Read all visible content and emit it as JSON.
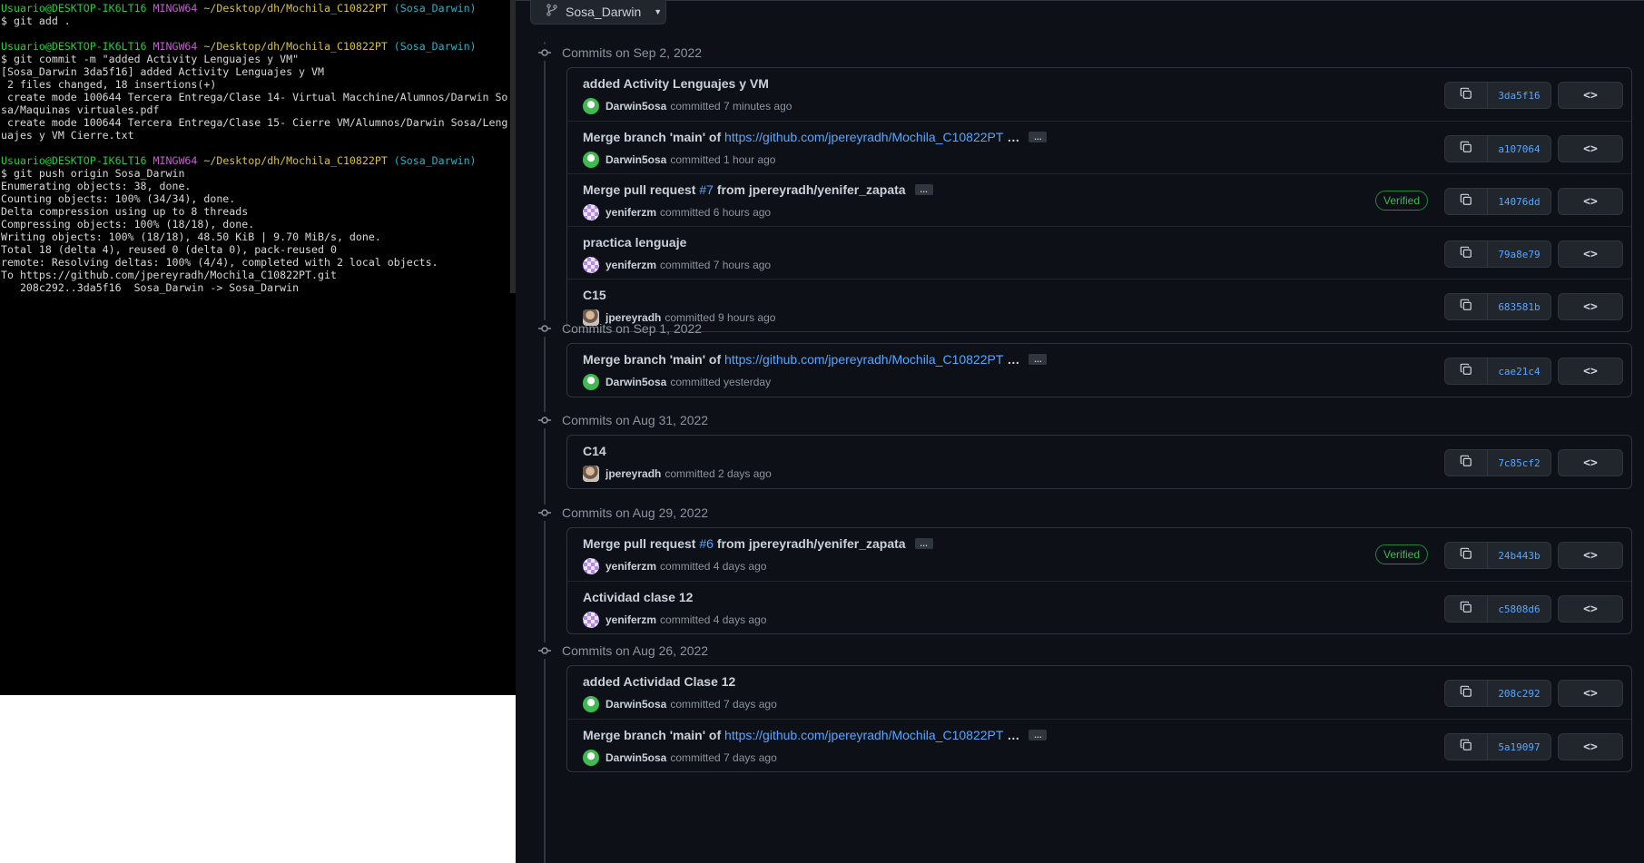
{
  "terminal": {
    "lines": [
      {
        "type": "prompt",
        "user": "Usuario@DESKTOP-IK6LT16",
        "sys": "MINGW64",
        "path": "~/Desktop/dh/Mochila_C10822PT",
        "branch": "(Sosa_Darwin)"
      },
      {
        "type": "text",
        "text": "$ git add ."
      },
      {
        "type": "blank"
      },
      {
        "type": "prompt",
        "user": "Usuario@DESKTOP-IK6LT16",
        "sys": "MINGW64",
        "path": "~/Desktop/dh/Mochila_C10822PT",
        "branch": "(Sosa_Darwin)"
      },
      {
        "type": "text",
        "text": "$ git commit -m \"added Activity Lenguajes y VM\""
      },
      {
        "type": "text",
        "text": "[Sosa_Darwin 3da5f16] added Activity Lenguajes y VM"
      },
      {
        "type": "text",
        "text": " 2 files changed, 18 insertions(+)"
      },
      {
        "type": "text",
        "text": " create mode 100644 Tercera Entrega/Clase 14- Virtual Macchine/Alumnos/Darwin So"
      },
      {
        "type": "text",
        "text": "sa/Maquinas virtuales.pdf"
      },
      {
        "type": "text",
        "text": " create mode 100644 Tercera Entrega/Clase 15- Cierre VM/Alumnos/Darwin Sosa/Leng"
      },
      {
        "type": "text",
        "text": "uajes y VM Cierre.txt"
      },
      {
        "type": "blank"
      },
      {
        "type": "prompt",
        "user": "Usuario@DESKTOP-IK6LT16",
        "sys": "MINGW64",
        "path": "~/Desktop/dh/Mochila_C10822PT",
        "branch": "(Sosa_Darwin)"
      },
      {
        "type": "text",
        "text": "$ git push origin Sosa_Darwin"
      },
      {
        "type": "text",
        "text": "Enumerating objects: 38, done."
      },
      {
        "type": "text",
        "text": "Counting objects: 100% (34/34), done."
      },
      {
        "type": "text",
        "text": "Delta compression using up to 8 threads"
      },
      {
        "type": "text",
        "text": "Compressing objects: 100% (18/18), done."
      },
      {
        "type": "text",
        "text": "Writing objects: 100% (18/18), 48.50 KiB | 9.70 MiB/s, done."
      },
      {
        "type": "text",
        "text": "Total 18 (delta 4), reused 0 (delta 0), pack-reused 0"
      },
      {
        "type": "text",
        "text": "remote: Resolving deltas: 100% (4/4), completed with 2 local objects."
      },
      {
        "type": "text",
        "text": "To https://github.com/jpereyradh/Mochila_C10822PT.git"
      },
      {
        "type": "text",
        "text": "   208c292..3da5f16  Sosa_Darwin -> Sosa_Darwin"
      }
    ]
  },
  "github": {
    "branch": "Sosa_Darwin",
    "groups": [
      {
        "heading": "Commits on Sep 2, 2022",
        "commits": [
          {
            "message": "added Activity Lenguajes y VM",
            "author": "Darwin5osa",
            "time": "committed 7 minutes ago",
            "sha": "3da5f16",
            "avatar": "green",
            "verified": "",
            "more": false
          },
          {
            "message": "Merge branch 'main' of",
            "link": "https://github.com/jpereyradh/Mochila_C10822PT",
            "message_tail": " …",
            "author": "Darwin5osa",
            "time": "committed 1 hour ago",
            "sha": "a107064",
            "avatar": "green",
            "verified": "",
            "more": true
          },
          {
            "message": "Merge pull request",
            "link": "#7",
            "message_tail": " from jpereyradh/yenifer_zapata",
            "author": "yeniferzm",
            "time": "committed 6 hours ago",
            "sha": "14076dd",
            "avatar": "purple",
            "verified": "Verified",
            "more": true
          },
          {
            "message": "practica lenguaje",
            "author": "yeniferzm",
            "time": "committed 7 hours ago",
            "sha": "79a8e79",
            "avatar": "purple",
            "verified": "",
            "more": false
          },
          {
            "message": "C15",
            "author": "jpereyradh",
            "time": "committed 9 hours ago",
            "sha": "683581b",
            "avatar": "photo",
            "verified": "",
            "more": false
          }
        ]
      },
      {
        "heading": "Commits on Sep 1, 2022",
        "commits": [
          {
            "message": "Merge branch 'main' of",
            "link": "https://github.com/jpereyradh/Mochila_C10822PT",
            "message_tail": " …",
            "author": "Darwin5osa",
            "time": "committed yesterday",
            "sha": "cae21c4",
            "avatar": "green",
            "verified": "",
            "more": true
          }
        ]
      },
      {
        "heading": "Commits on Aug 31, 2022",
        "commits": [
          {
            "message": "C14",
            "author": "jpereyradh",
            "time": "committed 2 days ago",
            "sha": "7c85cf2",
            "avatar": "photo",
            "verified": "",
            "more": false
          }
        ]
      },
      {
        "heading": "Commits on Aug 29, 2022",
        "commits": [
          {
            "message": "Merge pull request",
            "link": "#6",
            "message_tail": " from jpereyradh/yenifer_zapata",
            "author": "yeniferzm",
            "time": "committed 4 days ago",
            "sha": "24b443b",
            "avatar": "purple",
            "verified": "Verified",
            "more": true
          },
          {
            "message": "Actividad clase 12",
            "author": "yeniferzm",
            "time": "committed 4 days ago",
            "sha": "c5808d6",
            "avatar": "purple",
            "verified": "",
            "more": false
          }
        ]
      },
      {
        "heading": "Commits on Aug 26, 2022",
        "commits": [
          {
            "message": "added Actividad Clase 12",
            "author": "Darwin5osa",
            "time": "committed 7 days ago",
            "sha": "208c292",
            "avatar": "green",
            "verified": "",
            "more": false
          },
          {
            "message": "Merge branch 'main' of",
            "link": "https://github.com/jpereyradh/Mochila_C10822PT",
            "message_tail": " …",
            "author": "Darwin5osa",
            "time": "committed 7 days ago",
            "sha": "5a19097",
            "avatar": "green",
            "verified": "",
            "more": true
          }
        ]
      }
    ]
  },
  "icons": {
    "branch": "git-branch-icon",
    "commit_node": "git-commit-icon",
    "copy": "copy-icon",
    "browse": "code-brackets-icon"
  },
  "colors": {
    "terminal_bg": "#000000",
    "prompt_user": "#27c93f",
    "prompt_sys": "#c061cb",
    "prompt_path": "#d8c040",
    "prompt_branch": "#28b4c8",
    "github_bg": "#0d1117",
    "link": "#58a6ff",
    "verified": "#3fb950"
  }
}
